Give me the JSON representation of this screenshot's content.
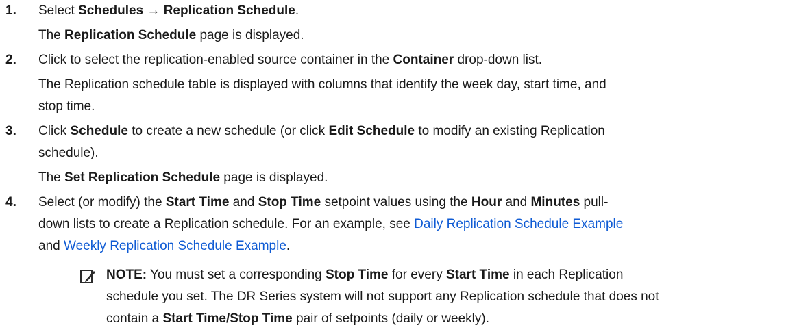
{
  "steps": [
    {
      "num": "1.",
      "instruction": {
        "t0": "Select ",
        "b0": "Schedules → Replication Schedule",
        "t1": "."
      },
      "result": {
        "t0": "The ",
        "b0": "Replication Schedule",
        "t1": " page is displayed."
      }
    },
    {
      "num": "2.",
      "instruction": {
        "t0": "Click to select the replication-enabled source container in the ",
        "b0": "Container",
        "t1": " drop-down list."
      },
      "result": {
        "line1": "The Replication schedule table is displayed with columns that identify the week day, start time, and",
        "line2": "stop time."
      }
    },
    {
      "num": "3.",
      "instruction": {
        "t0": "Click ",
        "b0": "Schedule",
        "t1": " to create a new schedule (or click ",
        "b1": "Edit Schedule",
        "t2": " to modify an existing Replication",
        "t3": "schedule)."
      },
      "result": {
        "t0": "The ",
        "b0": "Set Replication Schedule",
        "t1": " page is displayed."
      }
    },
    {
      "num": "4.",
      "instruction": {
        "t0": "Select (or modify) the ",
        "b0": "Start Time",
        "t1": " and ",
        "b1": "Stop Time",
        "t2": " setpoint values using the ",
        "b2": "Hour",
        "t3": " and ",
        "b3": "Minutes",
        "t4": " pull-",
        "t5": "down lists to create a Replication schedule. For an example, see ",
        "link1": "Daily Replication Schedule Example",
        "t6": "and ",
        "link2": "Weekly Replication Schedule Example",
        "t7": "."
      }
    }
  ],
  "note": {
    "icon": "pencil-note-icon",
    "label": "NOTE:",
    "t0": " You must set a corresponding ",
    "b0": "Stop Time",
    "t1": " for every ",
    "b1": "Start Time",
    "t2": " in each Replication",
    "line2": "schedule you set. The DR Series system will not support any Replication schedule that does not",
    "t3": "contain a ",
    "b2": "Start Time/Stop Time",
    "t4": " pair of setpoints (daily or weekly)."
  },
  "colors": {
    "text": "#1a1a1a",
    "link": "#0f5bd4"
  }
}
